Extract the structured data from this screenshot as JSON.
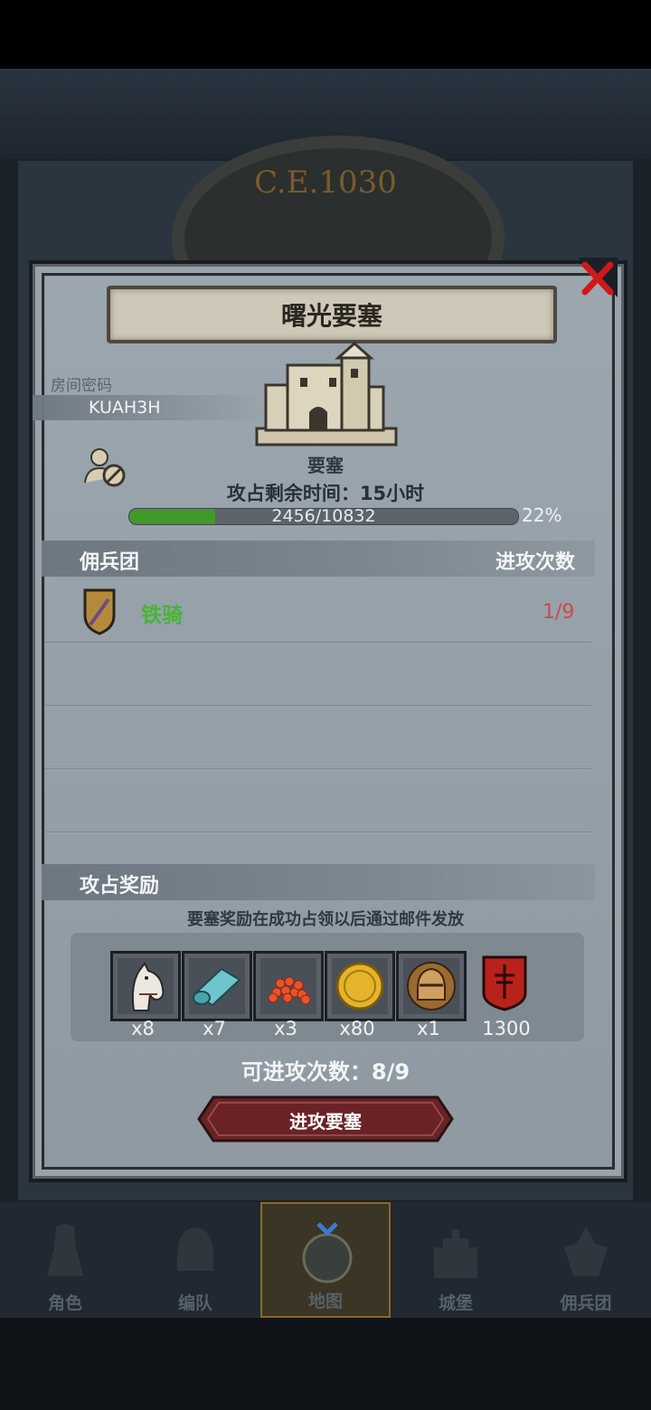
{
  "background": {
    "era_text": "C.E.1030"
  },
  "dialog": {
    "title": "曙光要塞",
    "room": {
      "label": "房间密码",
      "code": "KUAH3H"
    },
    "fortress_type": "要塞",
    "time_remaining": "攻占剩余时间：15小时",
    "progress": {
      "text": "2456/10832",
      "percent_text": "22%",
      "fraction": 0.22
    },
    "mercenary_section": {
      "title": "佣兵团",
      "attacks_header": "进攻次数"
    },
    "mercenaries": [
      {
        "name": "铁骑",
        "count": "1/9",
        "icon": "sword-shield-icon"
      }
    ],
    "rewards_section": {
      "title": "攻占奖励",
      "note": "要塞奖励在成功占领以后通过邮件发放",
      "items": [
        {
          "icon": "horse-icon",
          "count": "x8"
        },
        {
          "icon": "cloth-roll-icon",
          "count": "x7"
        },
        {
          "icon": "red-beads-icon",
          "count": "x3"
        },
        {
          "icon": "gold-coin-icon",
          "count": "x80"
        },
        {
          "icon": "helmet-icon",
          "count": "x1"
        },
        {
          "icon": "red-banner-icon",
          "count": "1300"
        }
      ]
    },
    "attacks_available": "可进攻次数：8/9",
    "attack_button": "进攻要塞"
  },
  "nav": [
    {
      "label": "角色",
      "icon": "knight-icon"
    },
    {
      "label": "编队",
      "icon": "helmet-icon"
    },
    {
      "label": "地图",
      "icon": "map-compass-icon",
      "active": true
    },
    {
      "label": "城堡",
      "icon": "castle-icon"
    },
    {
      "label": "佣兵团",
      "icon": "mercenary-icon"
    }
  ],
  "colors": {
    "accent_green": "#45b536",
    "count_red": "#c94a4a",
    "button_red": "#6b2226"
  }
}
